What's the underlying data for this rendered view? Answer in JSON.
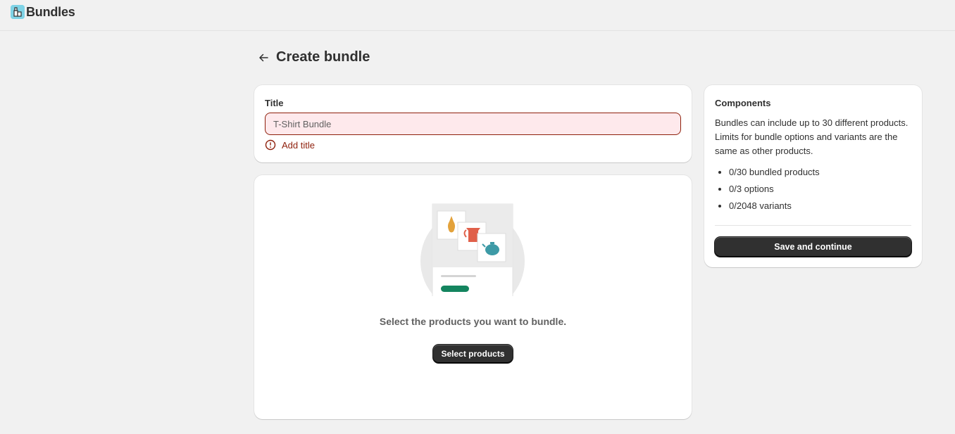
{
  "app": {
    "name": "Bundles",
    "icon": "bundles-app-icon"
  },
  "header": {
    "title": "Create bundle",
    "back_icon": "arrow-left-icon"
  },
  "title_card": {
    "label": "Title",
    "input_value": "T-Shirt Bundle",
    "error_text": "Add title",
    "error_icon": "alert-circle-icon",
    "error_color": "#8e1f0b",
    "input_bg": "#fee9ec"
  },
  "products_card": {
    "empty_text": "Select the products you want to bundle.",
    "select_button": "Select products"
  },
  "components_card": {
    "title": "Components",
    "description": "Bundles can include up to 30 different products. Limits for bundle options and variants are the same as other products.",
    "items": [
      "0/30 bundled products",
      "0/3 options",
      "0/2048 variants"
    ],
    "save_button": "Save and continue"
  },
  "colors": {
    "background": "#f1f1f1",
    "primary_button": "#303030",
    "accent_green": "#14855f"
  }
}
